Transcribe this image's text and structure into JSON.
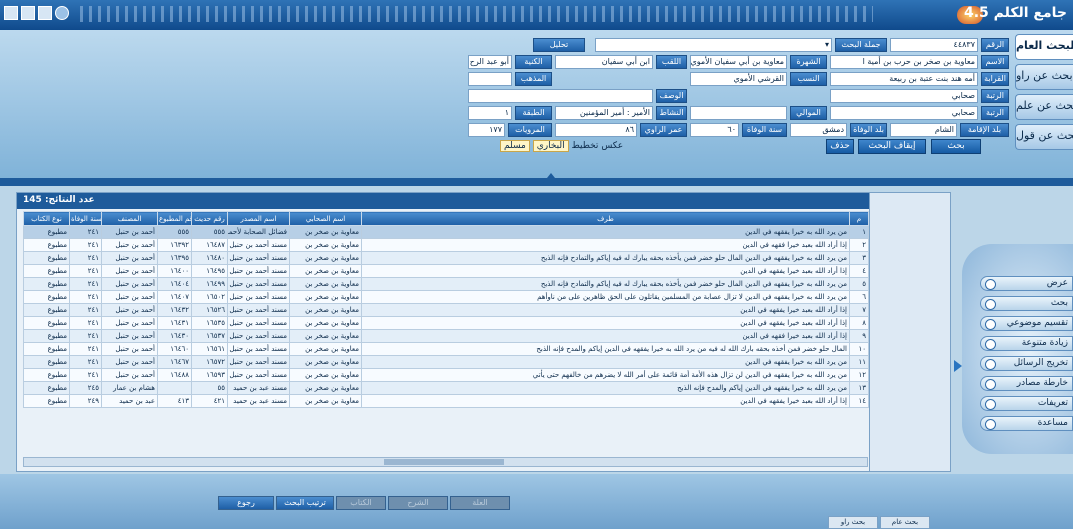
{
  "app_title": "جامع الكلم 4.5",
  "tabs": [
    "البحث العام",
    "بحث عن راو",
    "بحث عن علم",
    "بحث عن قول"
  ],
  "search": {
    "num_label": "الرقم",
    "num_value": "٤٤٨٣٧",
    "phrase_label": "جملة البحث",
    "extra_label": "تحليل",
    "name_label": "الاسم",
    "name_value": "معاوية بن صخر بن حرب بن أمية ا",
    "fame_label": "الشهرة",
    "fame_value": "معاوية بن أبي سفيان الأموي",
    "kunya_label": "الكنية",
    "kunya_value": "أبو عبد الرح",
    "laqab_label": "اللقب",
    "laqab_value": "ابن أبي سفيان",
    "kinship_label": "القرابة",
    "kinship_value": "أمه هند بنت عتبة بن ربيعة",
    "nasab_label": "النسب",
    "nasab_value": "القرشي الأموي",
    "madhhab_label": "المذهب",
    "wasf_label": "الوصف",
    "rutba_label": "الرتبة",
    "rutba_value": "صحابي",
    "mawali_label": "الموالي",
    "nashat_label": "النشاط",
    "nashat_value": "الأمير : أمير المؤمنين",
    "tabaqa_label": "الطبقة",
    "tabaqa_value": "١",
    "residence_label": "بلد الإقامة",
    "residence_value": "الشام",
    "death_country_label": "بلد الوفاة",
    "death_country_value": "دمشق",
    "death_year_label": "سنة الوفاة",
    "death_year_value": "٦٠",
    "age_label": "عمر الراوي",
    "age_value": "٨٦",
    "marwiyat_label": "المرويات",
    "marwiyat_value": "١٧٧"
  },
  "actions": {
    "search": "بحث",
    "stop": "إيقاف البحث",
    "delete": "حذف"
  },
  "books": {
    "label": "تخطيط",
    "options": [
      "عكس",
      "البخاري",
      "مسلم"
    ]
  },
  "grid": {
    "count_label": "عدد النتائج:",
    "count_value": "145",
    "columns": [
      "م",
      "طرف",
      "اسم الصحابي",
      "اسم المصدر",
      "رقم حديث",
      "رقم المطبوع",
      "المصنف",
      "سنة الوفاة",
      "نوع الكتاب"
    ],
    "rows": [
      {
        "n": "١",
        "tarf": "من يرد الله به خيرا يفقهه في الدين",
        "sahabi": "معاوية بن صخر بن",
        "source": "فضائل الصحابة لأحمد",
        "hadith": "٥٥٥",
        "print": "٥٥٥",
        "author": "أحمد بن حنبل",
        "death": "٢٤١",
        "type": "مطبوع"
      },
      {
        "n": "٢",
        "tarf": "إذا أراد الله بعبد خيرا فقهه في الدين",
        "sahabi": "معاوية بن صخر بن",
        "source": "مسند أحمد بن حنبل",
        "hadith": "١٦٤٨٧",
        "print": "١٦٣٩٢",
        "author": "أحمد بن حنبل",
        "death": "٢٤١",
        "type": "مطبوع"
      },
      {
        "n": "٣",
        "tarf": "من يرد الله به خيرا يفقهه في الدين المال حلو خضر فمن يأخذه بحقه يبارك له فيه إياكم والتمادح فإنه الذبح",
        "sahabi": "معاوية بن صخر بن",
        "source": "مسند أحمد بن حنبل",
        "hadith": "١٦٤٨٠",
        "print": "١٦٣٩٥",
        "author": "أحمد بن حنبل",
        "death": "٢٤١",
        "type": "مطبوع"
      },
      {
        "n": "٤",
        "tarf": "إذا أراد الله بعبد خيرا يفقهه في الدين",
        "sahabi": "معاوية بن صخر بن",
        "source": "مسند أحمد بن حنبل",
        "hadith": "١٦٤٩٥",
        "print": "١٦٤٠٠",
        "author": "أحمد بن حنبل",
        "death": "٢٤١",
        "type": "مطبوع"
      },
      {
        "n": "٥",
        "tarf": "من يرد الله به خيرا يفقهه في الدين المال حلو خضر فمن يأخذه بحقه يبارك له فيه إياكم والتمادح فإنه الذبح",
        "sahabi": "معاوية بن صخر بن",
        "source": "مسند أحمد بن حنبل",
        "hadith": "١٦٤٩٩",
        "print": "١٦٤٠٤",
        "author": "أحمد بن حنبل",
        "death": "٢٤١",
        "type": "مطبوع"
      },
      {
        "n": "٦",
        "tarf": "من يرد الله به خيرا يفقهه في الدين لا تزال عصابة من المسلمين يقاتلون على الحق ظاهرين على من ناوأهم",
        "sahabi": "معاوية بن صخر بن",
        "source": "مسند أحمد بن حنبل",
        "hadith": "١٦٥٠٢",
        "print": "١٦٤٠٧",
        "author": "أحمد بن حنبل",
        "death": "٢٤١",
        "type": "مطبوع"
      },
      {
        "n": "٧",
        "tarf": "إذا أراد الله بعبد خيرا يفقهه في الدين",
        "sahabi": "معاوية بن صخر بن",
        "source": "مسند أحمد بن حنبل",
        "hadith": "١٦٥٢٦",
        "print": "١٦٤٣٢",
        "author": "أحمد بن حنبل",
        "death": "٢٤١",
        "type": "مطبوع"
      },
      {
        "n": "٨",
        "tarf": "إذا أراد الله بعبد خيرا يفقهه في الدين",
        "sahabi": "معاوية بن صخر بن",
        "source": "مسند أحمد بن حنبل",
        "hadith": "١٦٥٣٥",
        "print": "١٦٤٣١",
        "author": "أحمد بن حنبل",
        "death": "٢٤١",
        "type": "مطبوع"
      },
      {
        "n": "٩",
        "tarf": "إذا أراد الله بعبد خيرا فقهه في الدين",
        "sahabi": "معاوية بن صخر بن",
        "source": "مسند أحمد بن حنبل",
        "hadith": "١٦٥٣٧",
        "print": "١٦٤٣٠",
        "author": "أحمد بن حنبل",
        "death": "٢٤١",
        "type": "مطبوع"
      },
      {
        "n": "١٠",
        "tarf": "المال حلو خضر فمن أخذه بحقه بارك الله له فيه من يرد الله به خيرا يفقهه في الدين إياكم والمدح فإنه الذبح",
        "sahabi": "معاوية بن صخر بن",
        "source": "مسند أحمد بن حنبل",
        "hadith": "١٦٥٦١",
        "print": "١٦٤٦٠",
        "author": "أحمد بن حنبل",
        "death": "٢٤١",
        "type": "مطبوع"
      },
      {
        "n": "١١",
        "tarf": "من يرد الله به خيرا يفقهه في الدين",
        "sahabi": "معاوية بن صخر بن",
        "source": "مسند أحمد بن حنبل",
        "hadith": "١٦٥٧٢",
        "print": "١٦٤٦٧",
        "author": "أحمد بن حنبل",
        "death": "٢٤١",
        "type": "مطبوع"
      },
      {
        "n": "١٢",
        "tarf": "من يرد الله به خيرا يفقهه في الدين لن تزال هذه الأمة أمة قائمة على أمر الله لا يضرهم من خالفهم حتى يأتي",
        "sahabi": "معاوية بن صخر بن",
        "source": "مسند أحمد بن حنبل",
        "hadith": "١٦٥٩٣",
        "print": "١٦٤٨٨",
        "author": "أحمد بن حنبل",
        "death": "٢٤١",
        "type": "مطبوع"
      },
      {
        "n": "١٣",
        "tarf": "من يرد الله به خيرا يفقهه في الدين إياكم والمدح فإنه الذبح",
        "sahabi": "معاوية بن صخر بن",
        "source": "مسند عبد بن حميد",
        "hadith": "٥٥",
        "print": "",
        "author": "هشام بن عمار",
        "death": "٢٤٥",
        "type": "مطبوع"
      },
      {
        "n": "١٤",
        "tarf": "إذا أراد الله بعبد خيرا يفقهه في الدين",
        "sahabi": "معاوية بن صخر بن",
        "source": "مسند عبد بن حميد",
        "hadith": "٤٢١",
        "print": "٤١٣",
        "author": "عبد بن حميد",
        "death": "٢٤٩",
        "type": "مطبوع"
      }
    ]
  },
  "bottom": {
    "buttons": [
      "رجوع",
      "ترتيب البحث",
      "الكتاب",
      "الشرح",
      "العلة"
    ],
    "status": [
      "بحث راو",
      "بحث عام"
    ]
  },
  "side_menu": [
    "عرض",
    "بحث",
    "تقسيم موضوعي",
    "زيادة متنوعة",
    "تخريج الرسائل",
    "خارطة مصادر",
    "تعريفات",
    "مساعدة"
  ]
}
